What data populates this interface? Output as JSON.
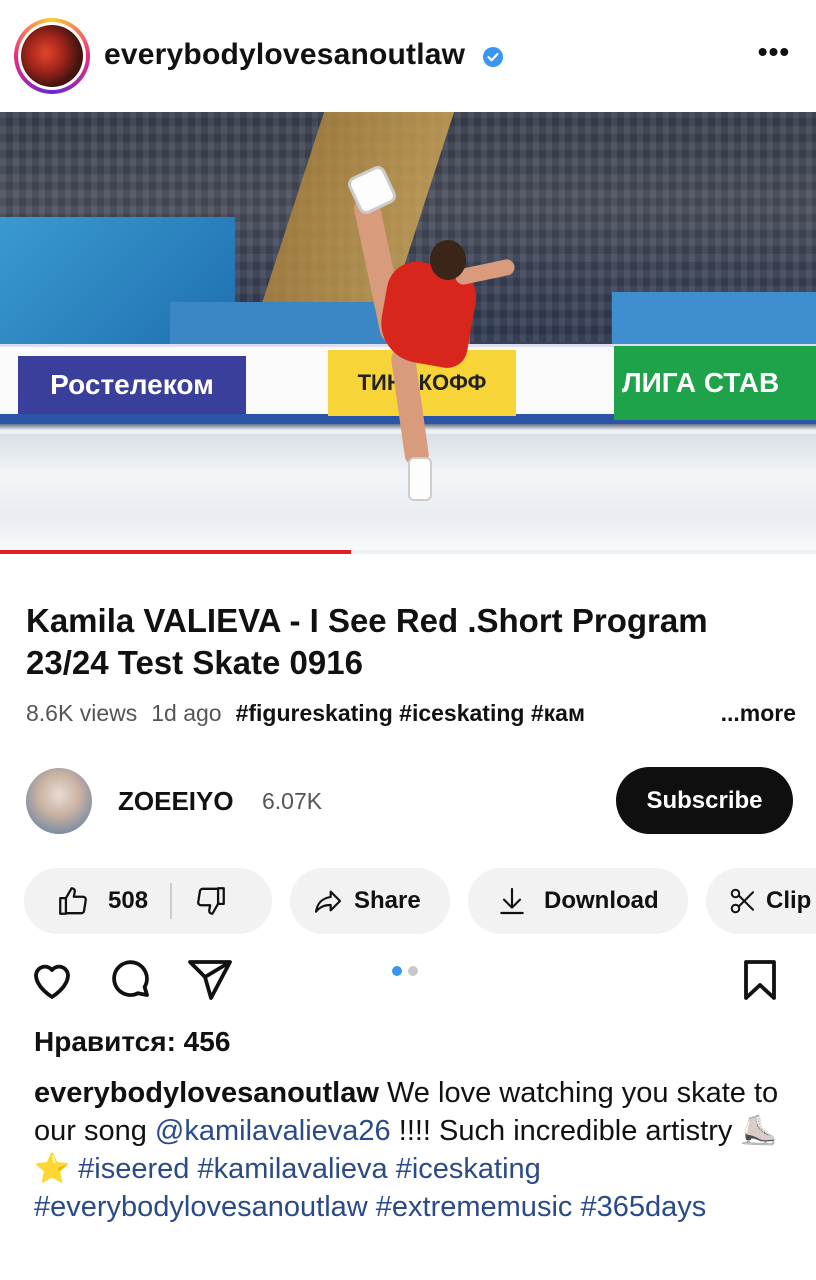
{
  "post_header": {
    "username": "everybodylovesanoutlaw",
    "verified": true,
    "more_icon": "more-horizontal-icon",
    "more_label": "•••"
  },
  "video": {
    "ads": {
      "rostelecom": "Ростелеком",
      "tinkoff": "ТИНЬКОФФ",
      "liga": "ЛИГА СТАВ"
    },
    "progress_fraction": 0.43,
    "progress_color": "#e21f26"
  },
  "youtube": {
    "title": "Kamila VALIEVA - I See Red .Short Program 23/24 Test Skate 0916",
    "views": "8.6K views",
    "age": "1d ago",
    "tags": "#figureskating #iceskating #кам",
    "more": "...more",
    "channel": {
      "name": "ZOEEIYO",
      "subscribers": "6.07K"
    },
    "subscribe_label": "Subscribe",
    "actions": {
      "like_count": "508",
      "share_label": "Share",
      "download_label": "Download",
      "clip_label": "Clip"
    }
  },
  "post_actions": {
    "icons": [
      "heart-icon",
      "comment-icon",
      "send-icon",
      "bookmark-icon"
    ],
    "carousel_dots": 2,
    "active_dot": 0,
    "active_color": "#3897f0"
  },
  "likes_text": "Нравится: 456",
  "caption": {
    "username": "everybodylovesanoutlaw",
    "text_1": " We love watching you skate to our song ",
    "mention": "@kamilavalieva26",
    "text_2": " !!!! Such incredible artistry ",
    "emoji": "⛸️⭐",
    "hashtags": "#iseered #kamilavalieva #iceskating #everybodylovesanoutlaw #extrememusic #365days"
  }
}
